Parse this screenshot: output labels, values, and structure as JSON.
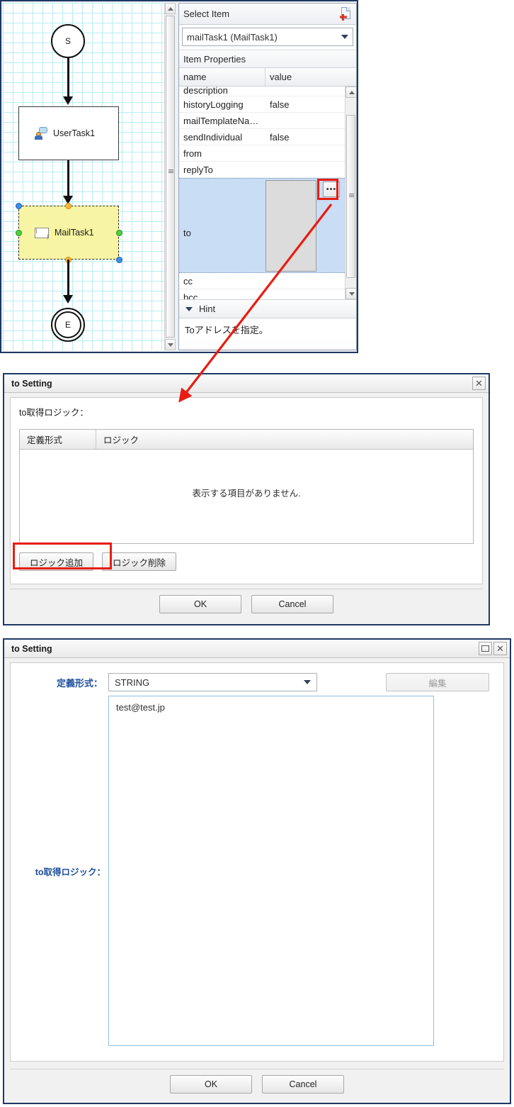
{
  "editor": {
    "diagram": {
      "start_node_label": "S",
      "end_node_label": "E",
      "user_task_label": "UserTask1",
      "mail_task_label": "MailTask1"
    },
    "properties_panel": {
      "header_title": "Select Item",
      "header_icon": "document-plugin-icon",
      "selected_item": "mailTask1 (MailTask1)",
      "section_title": "Item Properties",
      "columns": [
        "name",
        "value"
      ],
      "rows": [
        {
          "name": "description",
          "value": ""
        },
        {
          "name": "historyLogging",
          "value": "false"
        },
        {
          "name": "mailTemplateNa…",
          "value": ""
        },
        {
          "name": "sendIndividual",
          "value": "false"
        },
        {
          "name": "from",
          "value": ""
        },
        {
          "name": "replyTo",
          "value": ""
        },
        {
          "name": "to",
          "value": ""
        },
        {
          "name": "cc",
          "value": ""
        },
        {
          "name": "bcc",
          "value": ""
        }
      ],
      "ellipsis_button_label": "•••",
      "hint_section_label": "Hint",
      "hint_text": "Toアドレスを指定。"
    }
  },
  "dialog_list": {
    "title": "to Setting",
    "close_label": "✕",
    "field_label": "to取得ロジック：",
    "table": {
      "columns": [
        "定義形式",
        "ロジック"
      ],
      "rows": [],
      "empty_message": "表示する項目がありません."
    },
    "add_logic_label": "ロジック追加",
    "delete_logic_label": "ロジック削除",
    "ok_label": "OK",
    "cancel_label": "Cancel"
  },
  "dialog_edit": {
    "title": "to Setting",
    "restore_label": "□",
    "close_label": "✕",
    "format_label": "定義形式：",
    "format_value": "STRING",
    "format_options": [
      "STRING"
    ],
    "edit_button_label": "編集",
    "logic_label": "to取得ロジック：",
    "logic_value": "test@test.jp",
    "ok_label": "OK",
    "cancel_label": "Cancel"
  },
  "annotations": {
    "highlight_color": "#e81c12",
    "arrow_color": "#e81c12"
  }
}
